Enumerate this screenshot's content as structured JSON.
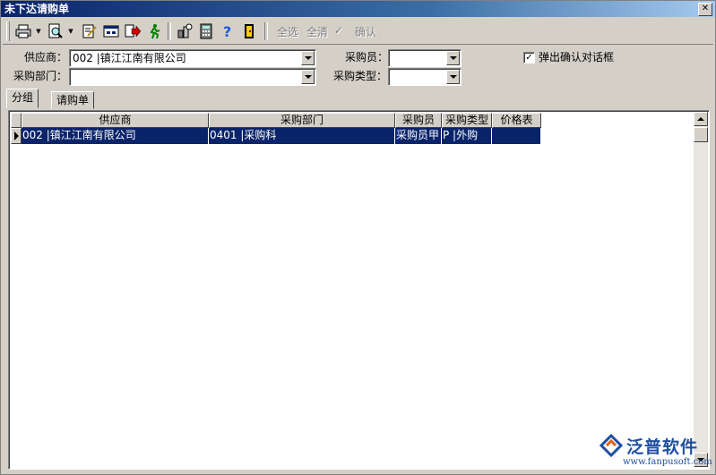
{
  "window": {
    "title": "未下达请购单",
    "close_glyph": "✕"
  },
  "toolbar": {
    "icons": [
      "print-icon",
      "print-preview-icon",
      "edit-icon",
      "window-icon",
      "export-icon",
      "run-icon",
      "network-icon",
      "calculator-icon",
      "help-icon",
      "exit-icon"
    ],
    "select_all": "全选",
    "clear_all": "全清",
    "confirm": "确认"
  },
  "filters": {
    "supplier_label": "供应商：",
    "supplier_value": "002 |镇江江南有限公司",
    "dept_label": "采购部门：",
    "dept_value": "",
    "buyer_label": "采购员：",
    "buyer_value": "",
    "type_label": "采购类型：",
    "type_value": "",
    "popup_checkbox_label": "弹出确认对话框",
    "popup_checked": true
  },
  "tabs": [
    {
      "label": "分组",
      "active": true
    },
    {
      "label": "请购单",
      "active": false
    }
  ],
  "grid": {
    "columns": [
      "供应商",
      "采购部门",
      "采购员",
      "采购类型",
      "价格表"
    ],
    "rows": [
      [
        "002 |镇江江南有限公司",
        "0401 |采购科",
        "采购员甲",
        "P |外购",
        ""
      ]
    ]
  },
  "brand": {
    "name": "泛普软件",
    "url": "www.fanpusoft.com"
  },
  "colors": {
    "selection": "#0a246a",
    "title_start": "#0a246a",
    "title_end": "#a6caf0",
    "face": "#d4d0c8"
  }
}
